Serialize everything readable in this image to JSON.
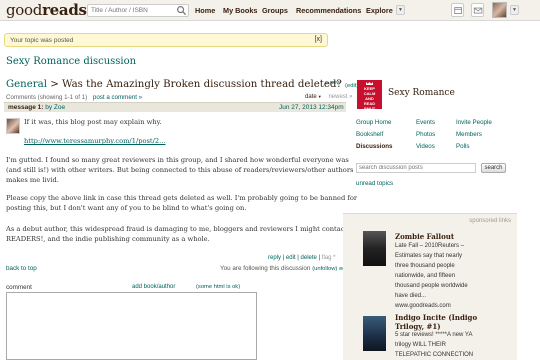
{
  "header": {
    "logo_light": "good",
    "logo_bold": "reads",
    "search_placeholder": "Title / Author / ISBN",
    "nav": [
      "Home",
      "My Books",
      "Groups",
      "Recommendations",
      "Explore"
    ]
  },
  "flash": {
    "message": "Your topic was posted",
    "close": "[x]"
  },
  "group": {
    "title": "Sexy Romance discussion"
  },
  "thread": {
    "crumb": "General",
    "separator": ">",
    "title": "Was the Amazingly Broken discussion thread deleted?",
    "edit": "(edit)",
    "new_label": "» new",
    "comments_count": "Comments (showing 1-1 of 1)",
    "post_comment": "post a comment »",
    "sort_date": "date",
    "sort_newest": "newest »"
  },
  "message": {
    "label": "message 1:",
    "author": "by Zoe",
    "date": "Jun 27, 2013 12:34pm",
    "lines": [
      "If it was, this blog post may explain why.",
      "http://www.teressamurphy.com/1/post/2...",
      "I'm gutted. I found so many great reviewers in this group, and I shared how wonderful everyone was",
      "(and still is!) with other writers. But being connected to this abuse of readers/reviewers/other authors",
      "makes me livid.",
      "Please copy the above link in case this thread gets deleted as well. I'm probably going to be banned for",
      "posting this, but I don't want any of you to be blind to what's going on.",
      "As a debut author, this widespread fraud is damaging to me, bloggers and reviewers I might contact,",
      "READERS!, and the indie publishing community as a whole."
    ],
    "actions": {
      "reply": "reply",
      "edit": "edit",
      "delete": "delete",
      "flag": "flag *",
      "sep": "|"
    }
  },
  "footer": {
    "back_to_top": "back to top",
    "following": "You are following this discussion",
    "unfollow": "(unfollow)",
    "edit": "edit"
  },
  "comment_box": {
    "label": "comment",
    "add_book": "add book/author",
    "some_html": "(some html is ok)"
  },
  "sidebar": {
    "group_image_text": [
      "KEEP",
      "CALM",
      "AND",
      "READ",
      "SMUT"
    ],
    "group_name": "Sexy Romance",
    "nav": [
      [
        "Group Home",
        "Events",
        "Invite People"
      ],
      [
        "Bookshelf",
        "Photos",
        "Members"
      ],
      [
        "Discussions",
        "Videos",
        "Polls"
      ]
    ],
    "search_placeholder": "search discussion posts",
    "search_button": "search",
    "unread": "unread topics"
  },
  "sponsored": {
    "label": "sponsored links",
    "books": [
      {
        "title": "Zombie Fallout",
        "desc": [
          "Late Fall – 2010Reuters –",
          "Estimates say that nearly",
          "three thousand people",
          "nationwide, and fifteen",
          "thousand people worldwide",
          "have died..."
        ],
        "url": "www.goodreads.com"
      },
      {
        "title": "Indigo Incite (Indigo",
        "title2": "Trilogy, #1)",
        "desc": [
          "5 star reviews! *****A new YA",
          "trilogy WILL THEIR",
          "TELEPATHIC CONNECTION"
        ]
      }
    ]
  },
  "colors": {
    "link": "#00635d",
    "brown": "#382110",
    "header_bg": "#f4f1ea",
    "flash_bg": "#fff8d5"
  }
}
